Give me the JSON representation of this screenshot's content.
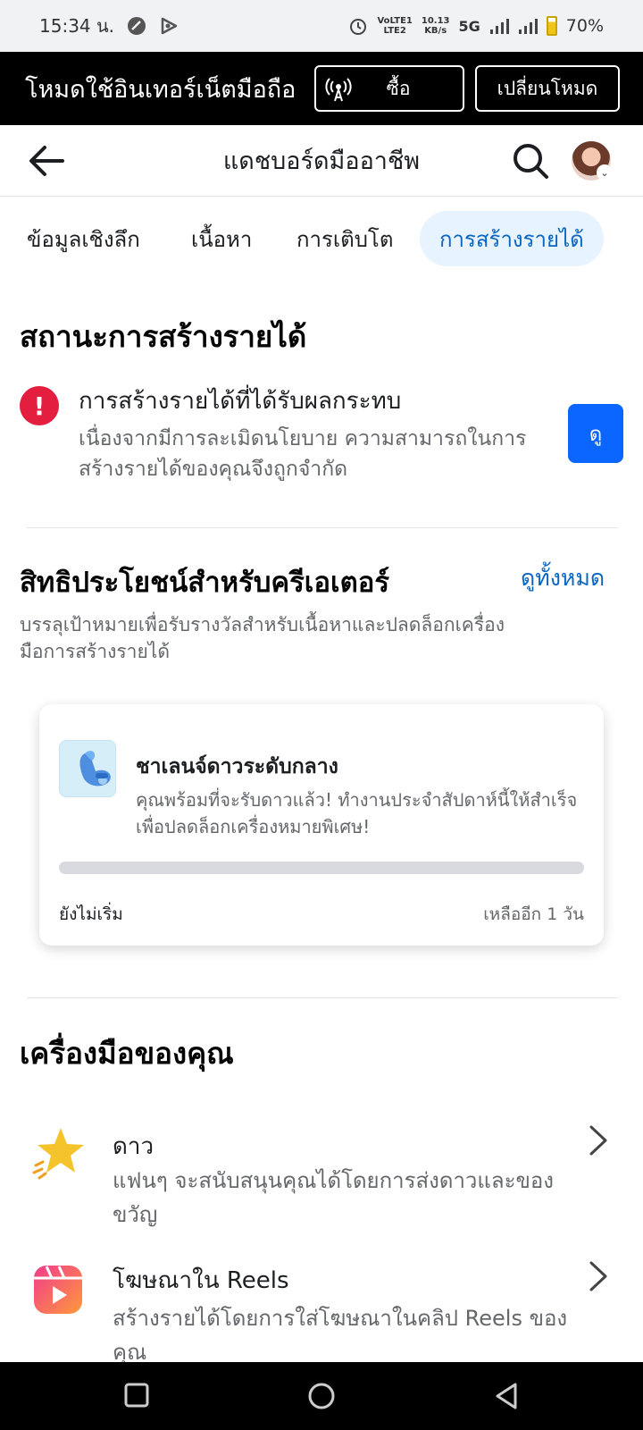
{
  "status_bar": {
    "time": "15:34 น.",
    "network_top": "VoLTE1",
    "network_bottom": "LTE2",
    "speed_top": "10.13",
    "speed_bottom": "KB/s",
    "network_type": "5G",
    "battery": "70%"
  },
  "data_banner": {
    "title": "โหมดใช้อินเทอร์เน็ตมือถือ",
    "buy_label": "ซื้อ",
    "switch_mode_label": "เปลี่ยนโหมด"
  },
  "header": {
    "title": "แดชบอร์ดมืออาชีพ"
  },
  "tabs": [
    {
      "label": "ข้อมูลเชิงลึก",
      "active": false
    },
    {
      "label": "เนื้อหา",
      "active": false
    },
    {
      "label": "การเติบโต",
      "active": false
    },
    {
      "label": "การสร้างรายได้",
      "active": true
    }
  ],
  "monetization_status": {
    "heading": "สถานะการสร้างรายได้",
    "alert_title": "การสร้างรายได้ที่ได้รับผลกระทบ",
    "alert_description": "เนื่องจากมีการละเมิดนโยบาย ความสามารถในการสร้างรายได้ของคุณจึงถูกจำกัด",
    "view_button": "ดู"
  },
  "creator_benefits": {
    "heading": "สิทธิประโยชน์สำหรับครีเอเตอร์",
    "see_all": "ดูทั้งหมด",
    "description": "บรรลุเป้าหมายเพื่อรับรางวัลสำหรับเนื้อหาและปลดล็อกเครื่องมือการสร้างรายได้",
    "challenge": {
      "title": "ชาเลนจ์ดาวระดับกลาง",
      "description": "คุณพร้อมที่จะรับดาวแล้ว! ทำงานประจำสัปดาห์นี้ให้สำเร็จเพื่อปลดล็อกเครื่องหมายพิเศษ!",
      "progress": 0,
      "status": "ยังไม่เริ่ม",
      "remaining": "เหลืออีก 1 วัน"
    }
  },
  "your_tools": {
    "heading": "เครื่องมือของคุณ",
    "items": [
      {
        "title": "ดาว",
        "description": "แฟนๆ จะสนับสนุนคุณได้โดยการส่งดาวและของขวัญ",
        "icon": "star-icon"
      },
      {
        "title": "โฆษณาใน Reels",
        "description": "สร้างรายได้โดยการใส่โฆษณาในคลิป Reels ของคุณ",
        "icon": "reels-icon"
      }
    ]
  },
  "colors": {
    "accent": "#0a66c2",
    "primary_button": "#0a66ff",
    "alert": "#e41e3f",
    "tab_active_bg": "#e7f3ff"
  }
}
